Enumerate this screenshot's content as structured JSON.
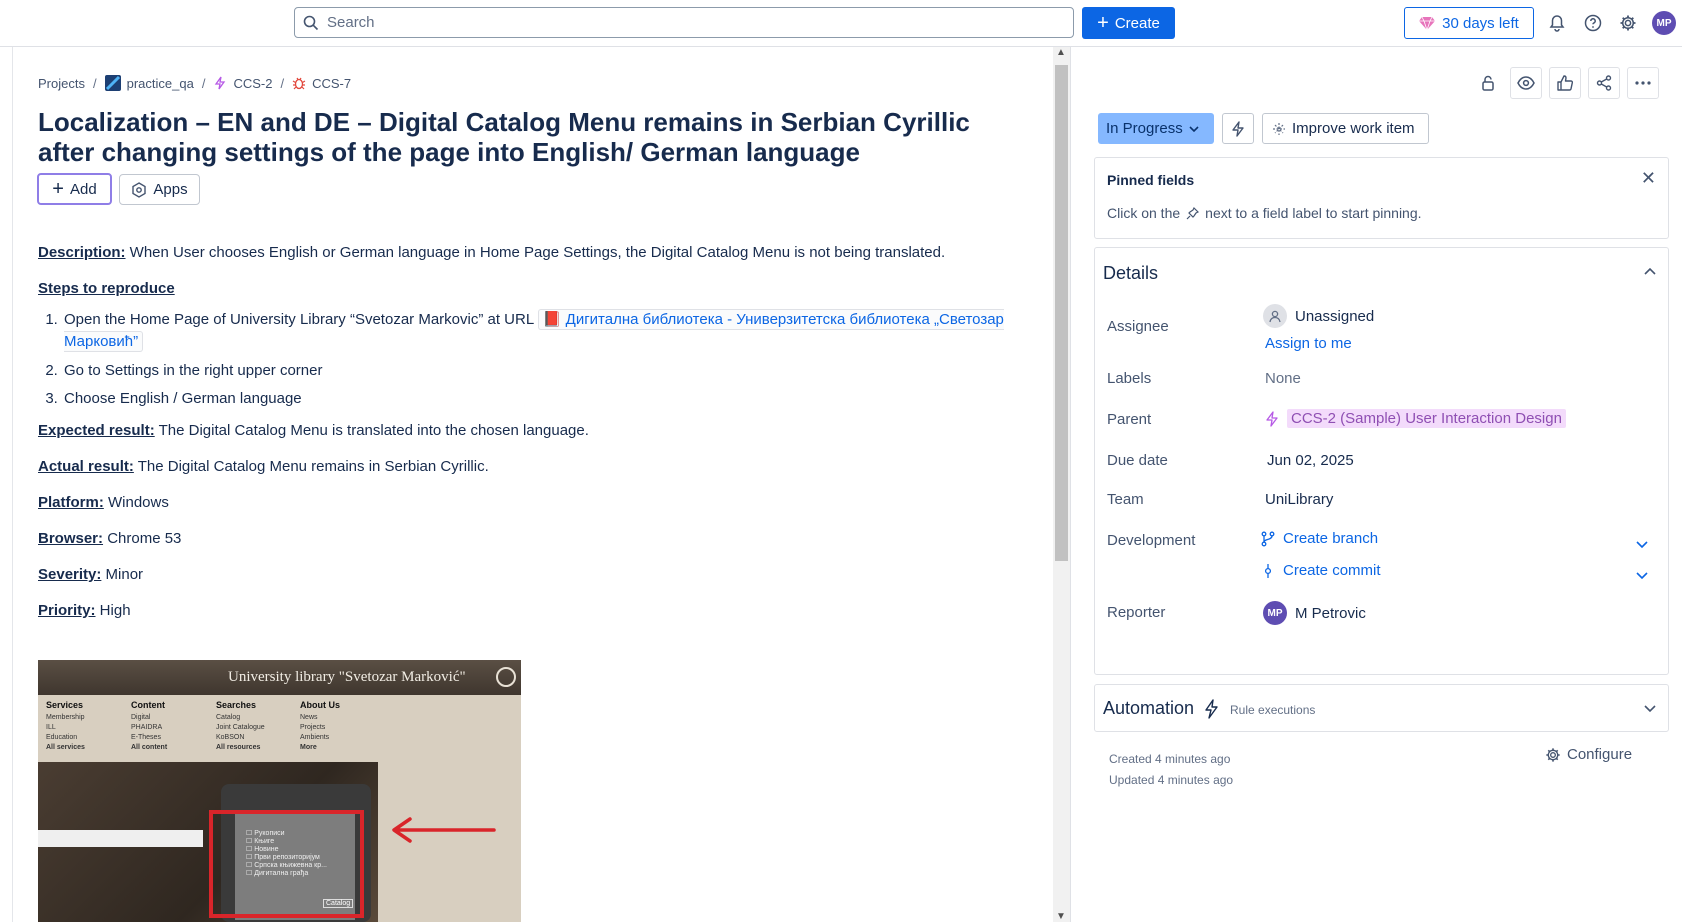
{
  "topbar": {
    "search_placeholder": "Search",
    "create_label": "Create",
    "trial_label": "30 days left",
    "avatar_initials": "MP",
    "brand_color": "#0c66e4"
  },
  "breadcrumb": {
    "projects": "Projects",
    "project": "practice_qa",
    "parent": "CCS-2",
    "current": "CCS-7"
  },
  "issue": {
    "title": "Localization – EN and DE – Digital Catalog Menu remains in Serbian Cyrillic after changing settings of the page into English/ German language",
    "add_label": "Add",
    "apps_label": "Apps"
  },
  "description": {
    "description_label": "Description:",
    "description_text": " When User chooses English or German language in Home Page Settings, the Digital Catalog Menu is not being translated.",
    "steps_label": "Steps to reproduce",
    "step1_text": "Open the Home Page of University Library “Svetozar Markovic” at URL ",
    "step1_link": "Дигитална библиотека - Универзитетска библиотека „Светозар Марковић”",
    "step2": "Go to Settings in the right upper corner",
    "step3": "Choose English / German language",
    "expected_label": "Expected result:",
    "expected_text": " The Digital Catalog Menu is translated into the chosen language.",
    "actual_label": "Actual result:",
    "actual_text": " The Digital Catalog Menu remains in Serbian Cyrillic.",
    "platform_label": "Platform:",
    "platform_text": " Windows",
    "browser_label": "Browser:",
    "browser_text": " Chrome 53",
    "severity_label": "Severity:",
    "severity_text": " Minor",
    "priority_label": "Priority:",
    "priority_text": " High"
  },
  "attachment": {
    "site_title": "University library \"Svetozar Marković\"",
    "menus": [
      {
        "heading": "Services",
        "items": [
          "Membership",
          "ILL",
          "Education"
        ],
        "all": "All services"
      },
      {
        "heading": "Content",
        "items": [
          "Digital",
          "PHAIDRA",
          "E-Theses"
        ],
        "all": "All content"
      },
      {
        "heading": "Searches",
        "items": [
          "Catalog",
          "Joint Catalogue",
          "KoBSON"
        ],
        "all": "All resources"
      },
      {
        "heading": "About Us",
        "items": [
          "News",
          "Projects",
          "Ambients"
        ],
        "all": "More"
      }
    ],
    "catalog_items": [
      "Рукописи",
      "Књиге",
      "Новине",
      "Први репозиторијум",
      "Српска књижевна кр...",
      "Дигитална грађа"
    ],
    "catalog_tag": "Catalog"
  },
  "sidebar": {
    "status": "In Progress",
    "status_color": "#85b8ff",
    "improve_label": "Improve work item",
    "pinned_title": "Pinned fields",
    "pinned_text_before": "Click on the",
    "pinned_text_after": "next to a field label to start pinning.",
    "details_title": "Details",
    "fields": {
      "assignee_label": "Assignee",
      "assignee_value": "Unassigned",
      "assign_to_me": "Assign to me",
      "labels_label": "Labels",
      "labels_value": "None",
      "parent_label": "Parent",
      "parent_value": "CCS-2 (Sample) User Interaction Design",
      "due_label": "Due date",
      "due_value": "Jun 02, 2025",
      "team_label": "Team",
      "team_value": "UniLibrary",
      "development_label": "Development",
      "create_branch": "Create branch",
      "create_commit": "Create commit",
      "reporter_label": "Reporter",
      "reporter_initials": "MP",
      "reporter_value": "M Petrovic"
    },
    "automation_title": "Automation",
    "automation_sub": "Rule executions",
    "created": "Created 4 minutes ago",
    "updated": "Updated 4 minutes ago",
    "configure_label": "Configure"
  }
}
